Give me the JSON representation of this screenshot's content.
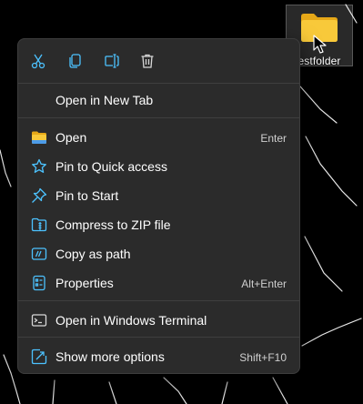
{
  "desktop": {
    "folder_label": "estfolder"
  },
  "toolbar": {
    "actions": [
      {
        "icon": "cut-icon"
      },
      {
        "icon": "copy-icon"
      },
      {
        "icon": "rename-icon"
      },
      {
        "icon": "delete-icon"
      }
    ]
  },
  "menu": {
    "items": [
      {
        "label": "Open in New Tab",
        "shortcut": "",
        "icon": ""
      },
      {
        "label": "Open",
        "shortcut": "Enter",
        "icon": "folder-icon"
      },
      {
        "label": "Pin to Quick access",
        "shortcut": "",
        "icon": "star-icon"
      },
      {
        "label": "Pin to Start",
        "shortcut": "",
        "icon": "pin-icon"
      },
      {
        "label": "Compress to ZIP file",
        "shortcut": "",
        "icon": "zip-icon"
      },
      {
        "label": "Copy as path",
        "shortcut": "",
        "icon": "copy-path-icon"
      },
      {
        "label": "Properties",
        "shortcut": "Alt+Enter",
        "icon": "properties-icon"
      },
      {
        "label": "Open in Windows Terminal",
        "shortcut": "",
        "icon": "terminal-icon"
      },
      {
        "label": "Show more options",
        "shortcut": "Shift+F10",
        "icon": "more-options-icon"
      }
    ]
  },
  "colors": {
    "menu_bg": "#2b2b2b",
    "icon_accent": "#4cc2ff",
    "folder_yellow": "#f8c93a"
  }
}
